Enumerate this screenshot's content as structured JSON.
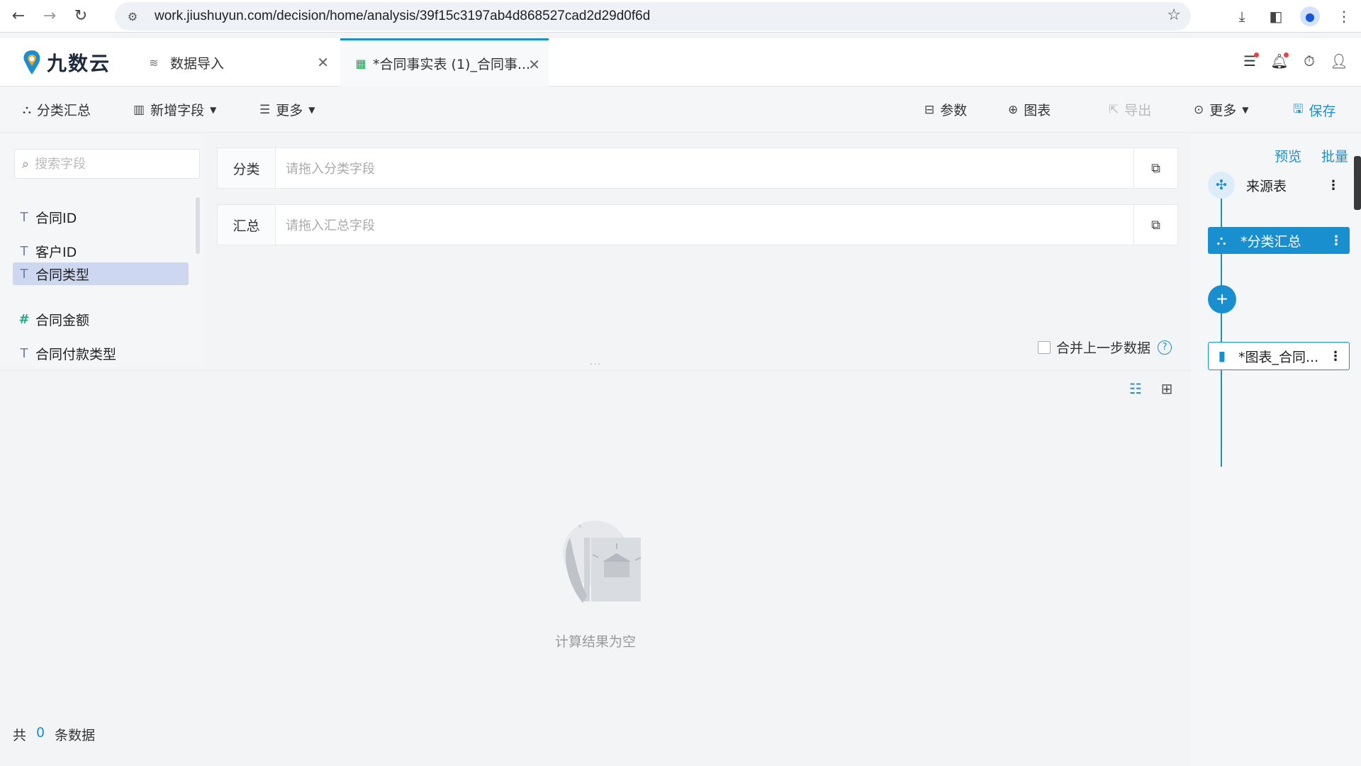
{
  "browser": {
    "url": "work.jiushuyun.com/decision/home/analysis/39f15c3197ab4d868527cad2d29d0f6d"
  },
  "app": {
    "logo_text": "九数云",
    "tabs": [
      {
        "label": "数据导入"
      },
      {
        "label": "*合同事实表 (1)_合同事..."
      }
    ],
    "colors": {
      "accent": "#1a8fd0",
      "active_field": "#cdd8f0"
    }
  },
  "toolbar": {
    "group_summary": "分类汇总",
    "add_field": "新增字段",
    "more_left": "更多",
    "params": "参数",
    "chart": "图表",
    "export": "导出",
    "more_right": "更多",
    "save": "保存"
  },
  "fields": {
    "search_placeholder": "搜索字段",
    "items": [
      {
        "type": "T",
        "label": "合同ID"
      },
      {
        "type": "T",
        "label": "客户ID"
      },
      {
        "type": "T",
        "label": "合同类型"
      },
      {
        "type": "#",
        "label": "合同金额"
      },
      {
        "type": "T",
        "label": "合同付款类型"
      }
    ]
  },
  "config": {
    "category_label": "分类",
    "category_placeholder": "请拖入分类字段",
    "summary_label": "汇总",
    "summary_placeholder": "请拖入汇总字段",
    "merge_label": "合并上一步数据",
    "help_icon": "?"
  },
  "result": {
    "empty_text": "计算结果为空",
    "footer_prefix": "共",
    "footer_count": "0",
    "footer_suffix": "条数据"
  },
  "flow": {
    "preview": "预览",
    "batch": "批量",
    "source_node": "来源表",
    "active_node": "*分类汇总",
    "chart_node": "*图表_合同..."
  }
}
